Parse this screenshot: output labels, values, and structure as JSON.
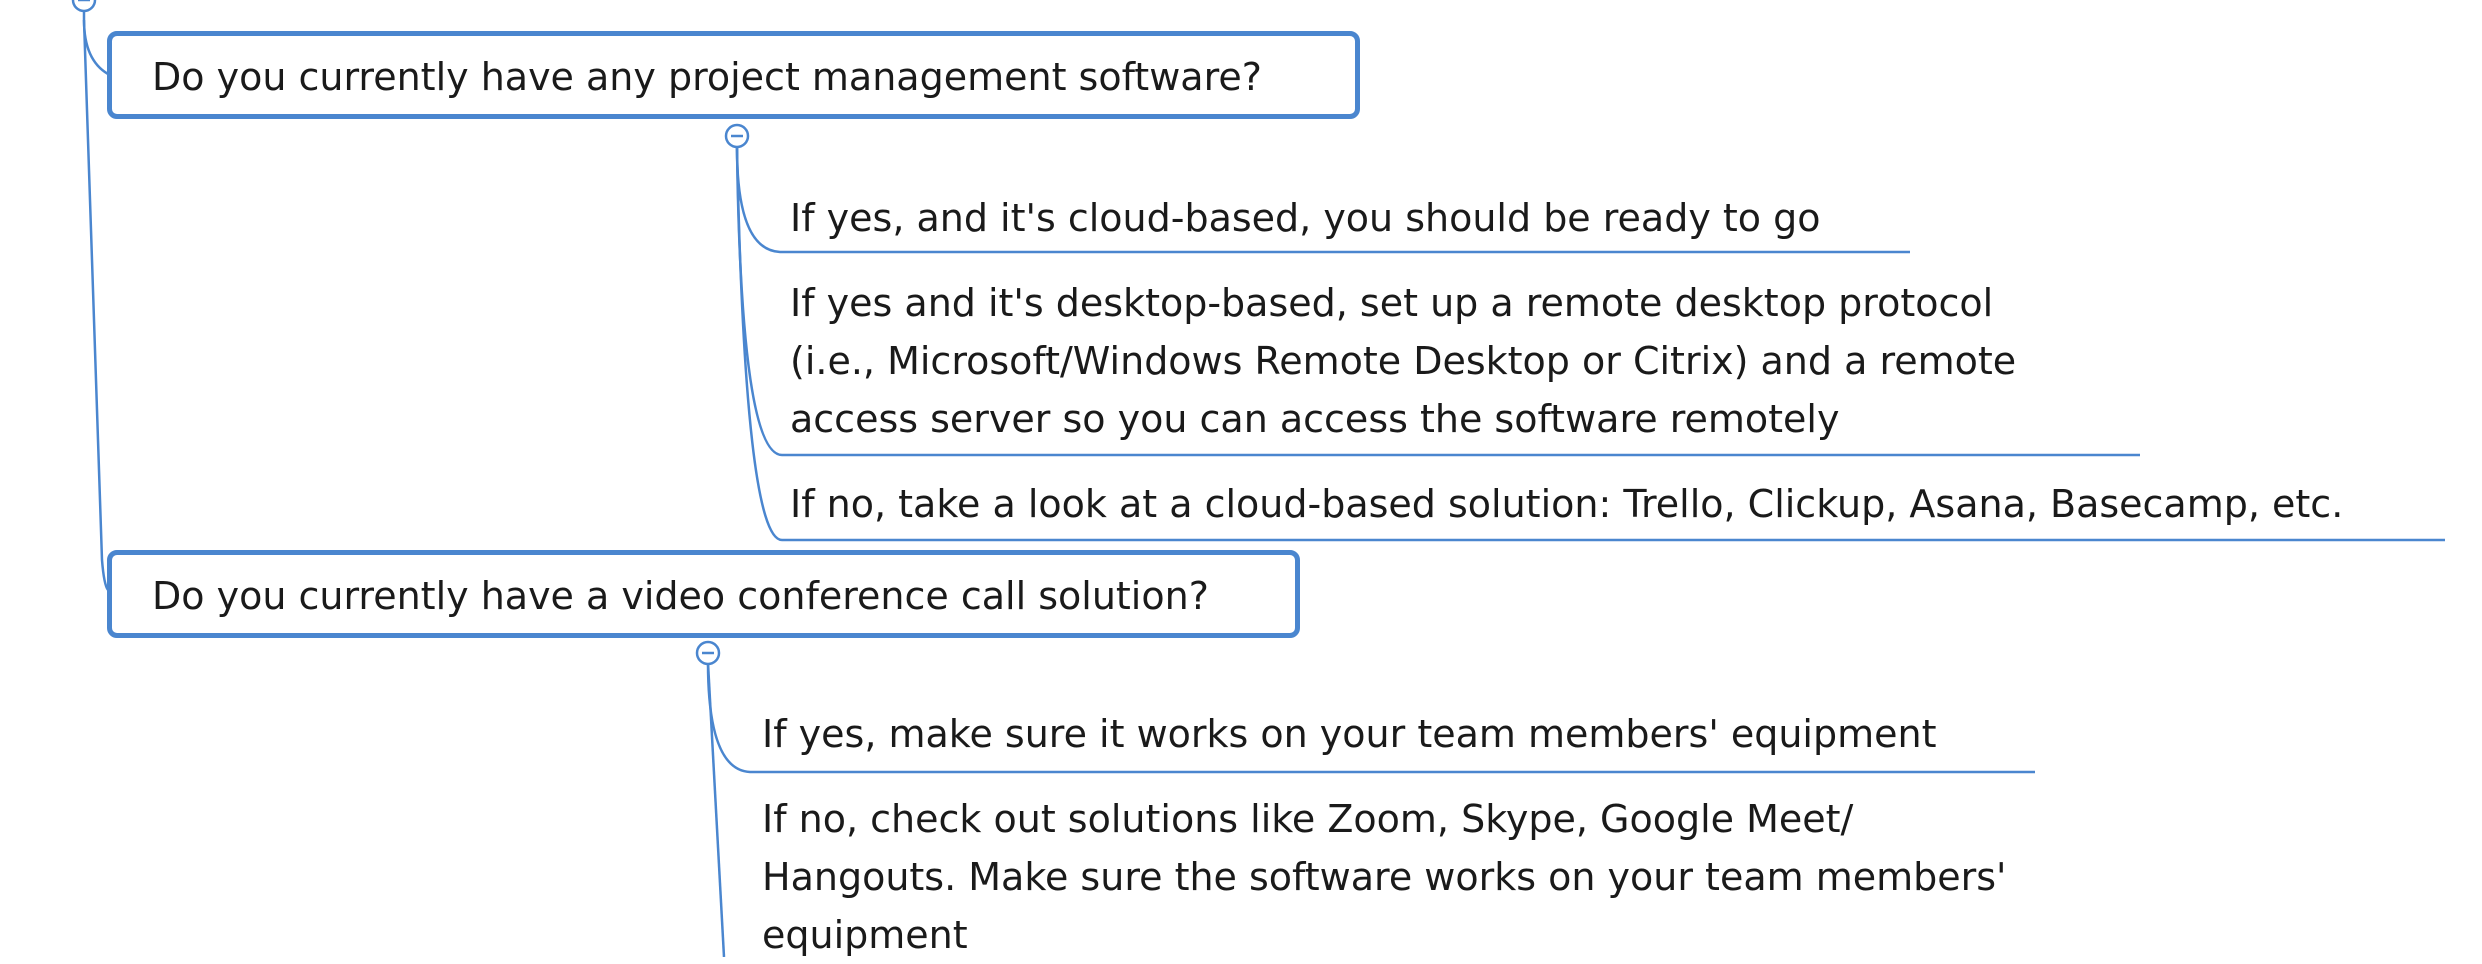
{
  "connector_color": "#4a86cf",
  "topics": [
    {
      "label": "Do you currently have any project management software?",
      "subtopics": [
        {
          "lines": [
            "If yes, and it's cloud-based, you should be ready to go"
          ]
        },
        {
          "lines": [
            "If yes and it's desktop-based, set up a remote desktop protocol",
            "(i.e., Microsoft/Windows Remote Desktop or Citrix) and a remote",
            "access server so you can access the software remotely"
          ]
        },
        {
          "lines": [
            "If no, take a look at a cloud-based solution: Trello, Clickup, Asana, Basecamp, etc."
          ]
        }
      ]
    },
    {
      "label": "Do you currently have a video conference call solution?",
      "subtopics": [
        {
          "lines": [
            "If yes, make sure it works on your team members' equipment"
          ]
        },
        {
          "lines": [
            "If no, check out solutions like Zoom, Skype, Google Meet/",
            "Hangouts. Make sure the software works on your team members'",
            "equipment"
          ]
        }
      ]
    }
  ]
}
